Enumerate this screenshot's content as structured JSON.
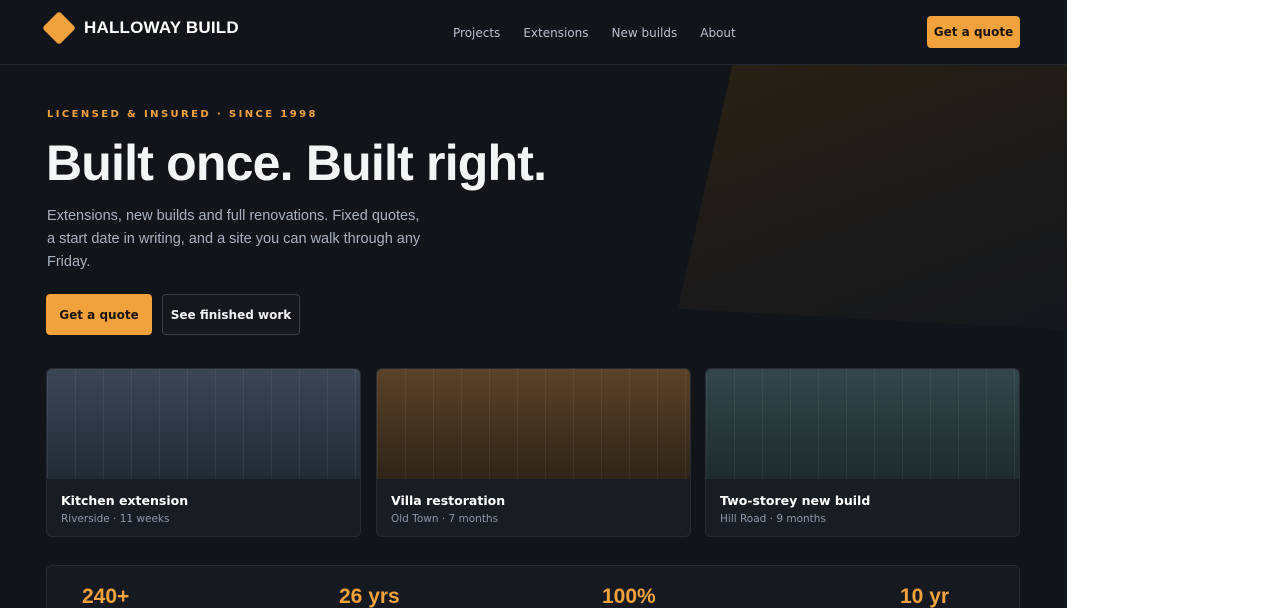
{
  "brand": {
    "name": "HALLOWAY BUILD",
    "accent": "#f2a23c"
  },
  "nav": {
    "items": [
      "Projects",
      "Extensions",
      "New builds",
      "About"
    ]
  },
  "header": {
    "cta_label": "Get a quote"
  },
  "hero": {
    "eyebrow": "LICENSED & INSURED · SINCE 1998",
    "headline": "Built once. Built right.",
    "lede": "Extensions, new builds and full renovations. Fixed quotes, a start date in writing, and a site you can walk through any Friday.",
    "primary_cta": "Get a quote",
    "secondary_cta": "See finished work"
  },
  "projects": [
    {
      "title": "Kitchen extension",
      "meta": "Riverside · 11 weeks",
      "tint": [
        "#3b4656",
        "#222a35"
      ]
    },
    {
      "title": "Villa restoration",
      "meta": "Old Town · 7 months",
      "tint": [
        "#5a4228",
        "#2e2418"
      ]
    },
    {
      "title": "Two-storey new build",
      "meta": "Hill Road · 9 months",
      "tint": [
        "#33464a",
        "#1d2b2c"
      ]
    }
  ],
  "stats": [
    "240+",
    "26 yrs",
    "100%",
    "10 yr"
  ]
}
